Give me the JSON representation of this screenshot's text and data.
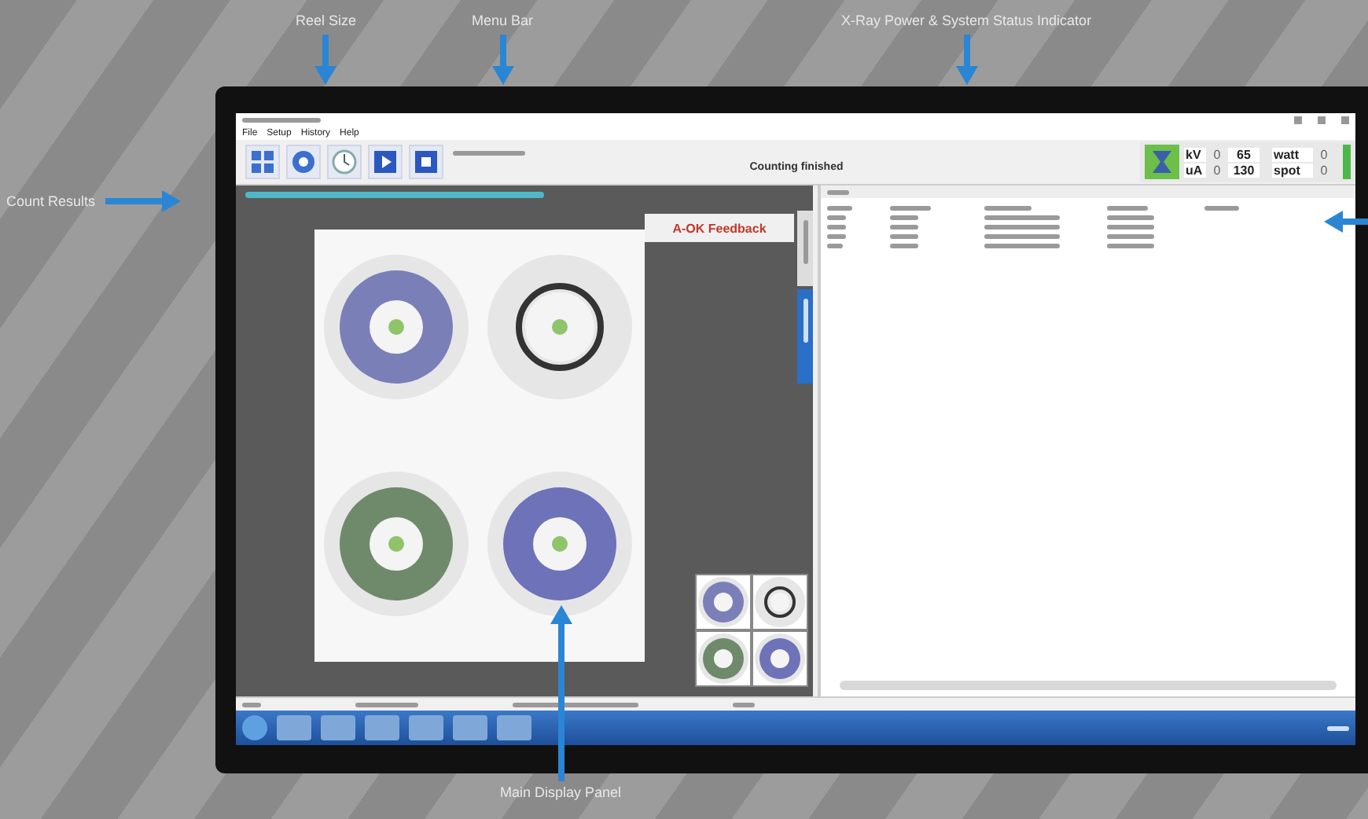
{
  "callouts": [
    {
      "label": "Reel Size"
    },
    {
      "label": "Menu Bar"
    },
    {
      "label": "X-Ray Power & System Status Indicator"
    },
    {
      "label": "Count Results"
    },
    {
      "label": "Main Display Panel"
    }
  ],
  "menu": [
    "File",
    "Setup",
    "History",
    "Help"
  ],
  "status_message": "Counting finished",
  "xray": [
    {
      "label": "kV",
      "value": "0",
      "setpoint": "65"
    },
    {
      "label": "watt",
      "value": "0"
    },
    {
      "label": "uA",
      "value": "0",
      "setpoint": "130"
    },
    {
      "label": "spot",
      "value": "0"
    }
  ],
  "feedback": "A-OK Feedback"
}
